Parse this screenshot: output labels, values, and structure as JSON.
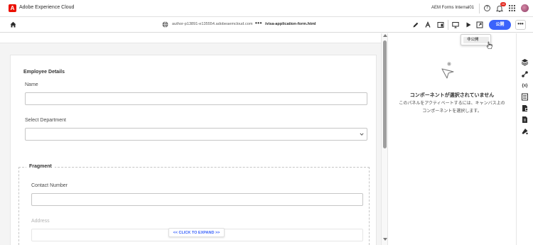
{
  "app": {
    "logo_letter": "A",
    "name": "Adobe Experience Cloud",
    "org": "AEM Forms Internal01",
    "notification_count": "10",
    "help_glyph": "?"
  },
  "toolbar": {
    "host": "author-p13891-e135554.adobeaemcloud.com",
    "more_path": "•••",
    "path": "/visa-application-form.html",
    "publish_label": "公開",
    "more_label": "•••"
  },
  "menu": {
    "items": [
      {
        "label": "非公開"
      }
    ]
  },
  "form": {
    "section_title": "Employee Details",
    "name_label": "Name",
    "department_label": "Select Department",
    "fragment_title": "Fragment",
    "contact_label": "Contact Number",
    "address_label": "Address",
    "expand_label": "<< CLICK TO EXPAND >>"
  },
  "panel": {
    "empty_title": "コンポーネントが選択されていません",
    "empty_desc": "このパネルをアクティベートするには、キャンバス上のコンポーネントを選択します。"
  },
  "rail": {
    "variables_label": "{x}"
  },
  "colors": {
    "accent": "#3b63fb",
    "brand_red": "#eb1000",
    "badge_red": "#e3251c"
  },
  "icons": [
    "adobe-logo",
    "help-icon",
    "bell-icon",
    "apps-icon",
    "avatar",
    "home-icon",
    "globe-icon",
    "edit-icon",
    "share-icon",
    "device-icon",
    "desktop-icon",
    "play-icon",
    "open-icon",
    "cursor-pointer",
    "empty-selection-icon",
    "layers-icon",
    "connector-icon",
    "variables-icon",
    "form-icon",
    "data-icon",
    "fragment-icon",
    "style-icon"
  ]
}
